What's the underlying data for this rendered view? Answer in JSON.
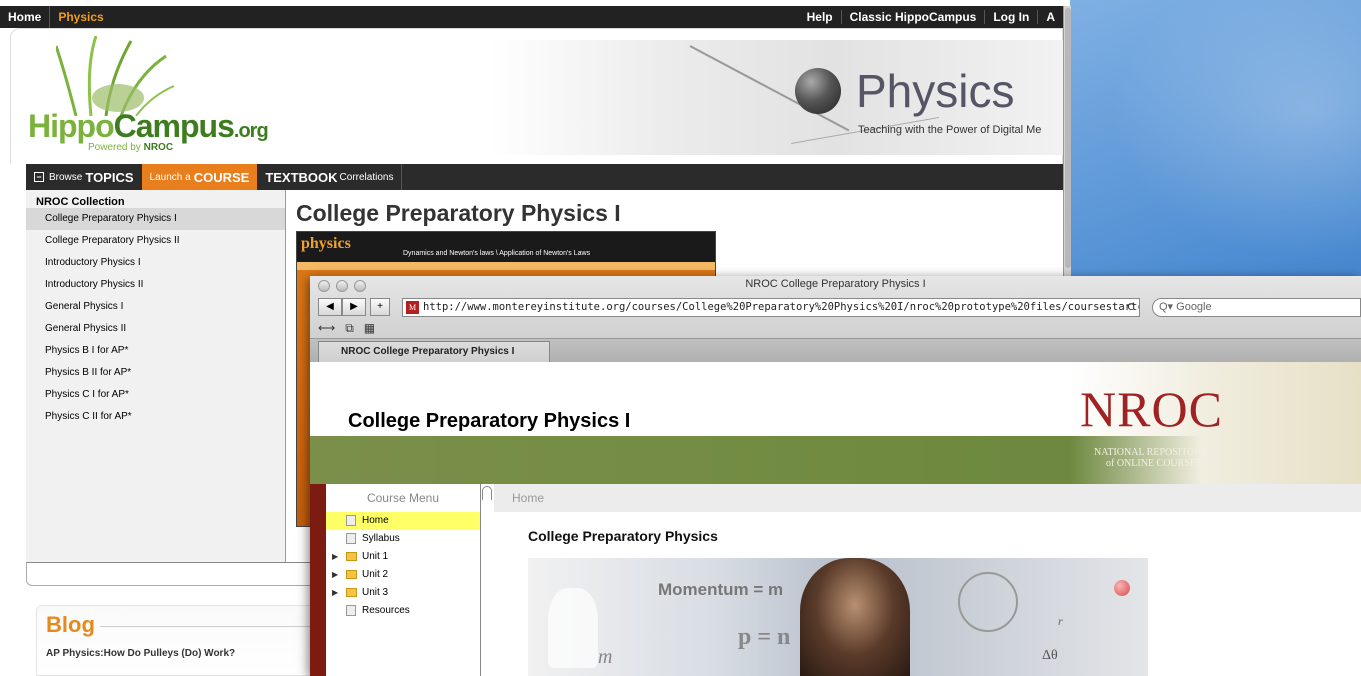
{
  "hippo": {
    "topnav_left": [
      "Home",
      "Physics"
    ],
    "topnav_right": [
      "Help",
      "Classic HippoCampus",
      "Log In",
      "A"
    ],
    "logo": {
      "word_a": "Hippo",
      "word_b": "Campus",
      "org": ".org",
      "powered": "Powered by ",
      "nroc": "NROC"
    },
    "banner": {
      "title": "Physics",
      "subtitle": "Teaching with the Power of Digital Me"
    },
    "tabs": {
      "browse_small": "Browse",
      "browse": "TOPICS",
      "launch_small": "Launch a",
      "launch": "COURSE",
      "textbook": "TEXTBOOK",
      "textbook_small": "Correlations"
    },
    "sidebar": {
      "heading": "NROC Collection",
      "items": [
        "College Preparatory Physics I",
        "College Preparatory Physics II",
        "Introductory Physics I",
        "Introductory Physics II",
        "General Physics I",
        "General Physics II",
        "Physics B I for AP*",
        "Physics B II for AP*",
        "Physics C I for AP*",
        "Physics C II for AP*"
      ],
      "selected_index": 0
    },
    "course_title": "College Preparatory Physics I",
    "book": {
      "logo": "physics",
      "path": "Dynamics and Newton's laws \\ Application of Newton's Laws"
    },
    "blog": {
      "heading": "Blog",
      "post": "AP Physics:How Do Pulleys (Do) Work?"
    }
  },
  "safari": {
    "window_title": "NROC College Preparatory Physics I",
    "url": "http://www.montereyinstitute.org/courses/College%20Preparatory%20Physics%20I/nroc%20prototype%20files/coursestartc.html",
    "search_placeholder": "Google",
    "tab_label": "NROC College Preparatory Physics I",
    "nav": {
      "back": "◀",
      "forward": "▶",
      "add": "+",
      "reload": "C",
      "favicon": "M"
    },
    "bookmarks": [
      "⟷",
      "⧉",
      "▦"
    ]
  },
  "nroc": {
    "course_title": "College Preparatory Physics I",
    "logo": "NROC",
    "logo_sub1": "NATIONAL REPOSITORY",
    "logo_sub2": "of ONLINE COURSES",
    "menu_heading": "Course Menu",
    "breadcrumb": "Home",
    "menu_items": [
      {
        "label": "Home",
        "type": "page",
        "selected": true
      },
      {
        "label": "Syllabus",
        "type": "page"
      },
      {
        "label": "Unit 1",
        "type": "folder"
      },
      {
        "label": "Unit 2",
        "type": "folder"
      },
      {
        "label": "Unit 3",
        "type": "folder"
      },
      {
        "label": "Resources",
        "type": "page"
      }
    ],
    "content_title": "College Preparatory Physics",
    "hero": {
      "momentum": "Momentum =",
      "m_partial": "m",
      "p": "p =",
      "n_partial": "n",
      "m": "m",
      "r": "r",
      "delta_theta": "Δθ"
    }
  },
  "colors": {
    "accent_orange": "#e87e1c",
    "nroc_green": "#6f8a3f",
    "nroc_red": "#9f2323",
    "menu_select": "#ffff66"
  }
}
